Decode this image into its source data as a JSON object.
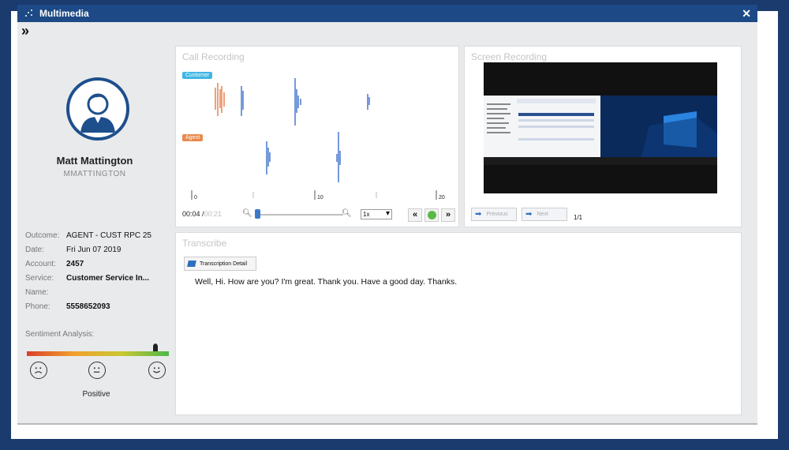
{
  "window": {
    "title": "Multimedia",
    "close": "✕",
    "expand": "»"
  },
  "user": {
    "name": "Matt Mattington",
    "id": "MMATTINGTON"
  },
  "details": [
    {
      "label": "Outcome:",
      "value": "AGENT - CUST RPC 25",
      "bold": false
    },
    {
      "label": "Date:",
      "value": "Fri Jun 07 2019",
      "bold": false
    },
    {
      "label": "Account:",
      "value": "2457",
      "bold": true
    },
    {
      "label": "Service:",
      "value": "Customer Service In...",
      "bold": true
    },
    {
      "label": "Name:",
      "value": "",
      "bold": false
    },
    {
      "label": "Phone:",
      "value": "5558652093",
      "bold": true
    }
  ],
  "sentiment": {
    "label": "Sentiment Analysis:",
    "result": "Positive",
    "level": 0.92
  },
  "call_recording": {
    "title": "Call Recording",
    "customer_tag": "Customer",
    "agent_tag": "Agent",
    "customer_color": "#3fb6e4",
    "agent_color": "#e78a4e",
    "ticks": [
      "0",
      "10",
      "20"
    ],
    "time_current": "00:04 /",
    "time_total": "00:21",
    "speed": "1x"
  },
  "screen_recording": {
    "title": "Screen Recording",
    "prev": "Previous",
    "next": "Next",
    "page": "1/1"
  },
  "transcribe": {
    "title": "Transcribe",
    "button": "Transcription Detail",
    "text": "Well, Hi. How are you? I'm great. Thank you. Have a good day. Thanks."
  },
  "colors": {
    "frame": "#1b3a6e",
    "titlebar": "#1d4a86",
    "accent": "#2d6fbd"
  }
}
